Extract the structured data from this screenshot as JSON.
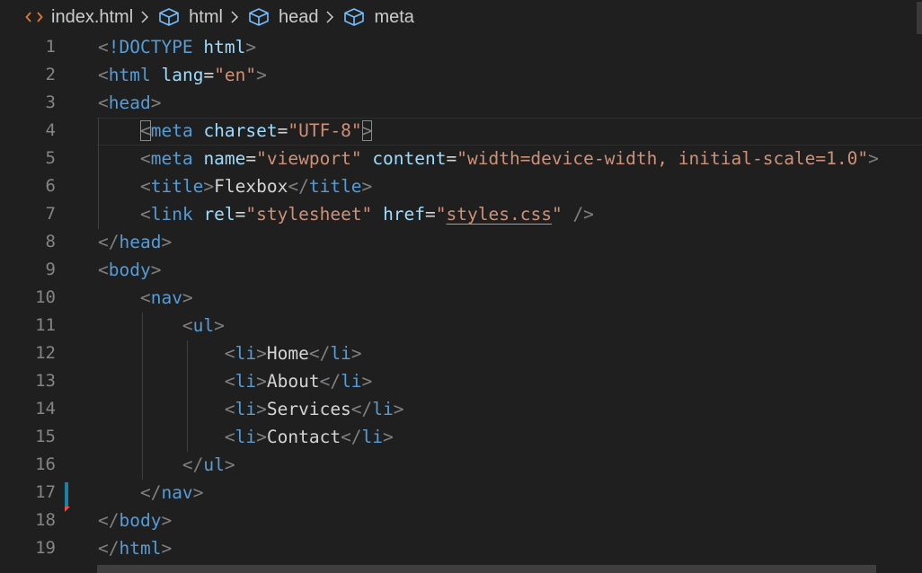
{
  "breadcrumb": {
    "file": "index.html",
    "file_icon": "code-brackets-icon",
    "items": [
      {
        "label": "html",
        "icon": "cube-icon"
      },
      {
        "label": "head",
        "icon": "cube-icon"
      },
      {
        "label": "meta",
        "icon": "cube-icon"
      }
    ]
  },
  "colors": {
    "background": "#1f1f1f",
    "line_number": "#858585",
    "punctuation": "#808080",
    "tag": "#569cd6",
    "attribute": "#9cdcfe",
    "string": "#ce9178",
    "text": "#d4d4d4",
    "git_modified": "#1b81a8",
    "git_deleted": "#f14c4c"
  },
  "editor": {
    "active_line": 4,
    "lines": [
      {
        "n": "1",
        "tokens": [
          [
            "p",
            "<"
          ],
          [
            "t",
            "!DOCTYPE"
          ],
          [
            "x",
            " "
          ],
          [
            "a",
            "html"
          ],
          [
            "p",
            ">"
          ]
        ]
      },
      {
        "n": "2",
        "tokens": [
          [
            "p",
            "<"
          ],
          [
            "t",
            "html"
          ],
          [
            "x",
            " "
          ],
          [
            "a",
            "lang"
          ],
          [
            "x",
            "="
          ],
          [
            "s",
            "\"en\""
          ],
          [
            "p",
            ">"
          ]
        ]
      },
      {
        "n": "3",
        "tokens": [
          [
            "p",
            "<"
          ],
          [
            "t",
            "head"
          ],
          [
            "p",
            ">"
          ]
        ]
      },
      {
        "n": "4",
        "tokens": [
          [
            "x",
            "    "
          ],
          [
            "p",
            "<"
          ],
          [
            "t",
            "meta"
          ],
          [
            "x",
            " "
          ],
          [
            "a",
            "charset"
          ],
          [
            "x",
            "="
          ],
          [
            "s",
            "\"UTF-8\""
          ],
          [
            "p",
            ">"
          ]
        ]
      },
      {
        "n": "5",
        "tokens": [
          [
            "x",
            "    "
          ],
          [
            "p",
            "<"
          ],
          [
            "t",
            "meta"
          ],
          [
            "x",
            " "
          ],
          [
            "a",
            "name"
          ],
          [
            "x",
            "="
          ],
          [
            "s",
            "\"viewport\""
          ],
          [
            "x",
            " "
          ],
          [
            "a",
            "content"
          ],
          [
            "x",
            "="
          ],
          [
            "s",
            "\"width=device-width, initial-scale=1.0\""
          ],
          [
            "p",
            ">"
          ]
        ]
      },
      {
        "n": "6",
        "tokens": [
          [
            "x",
            "    "
          ],
          [
            "p",
            "<"
          ],
          [
            "t",
            "title"
          ],
          [
            "p",
            ">"
          ],
          [
            "x",
            "Flexbox"
          ],
          [
            "p",
            "</"
          ],
          [
            "t",
            "title"
          ],
          [
            "p",
            ">"
          ]
        ]
      },
      {
        "n": "7",
        "tokens": [
          [
            "x",
            "    "
          ],
          [
            "p",
            "<"
          ],
          [
            "t",
            "link"
          ],
          [
            "x",
            " "
          ],
          [
            "a",
            "rel"
          ],
          [
            "x",
            "="
          ],
          [
            "s",
            "\"stylesheet\""
          ],
          [
            "x",
            " "
          ],
          [
            "a",
            "href"
          ],
          [
            "x",
            "="
          ],
          [
            "s",
            "\""
          ],
          [
            "su",
            "styles.css"
          ],
          [
            "s",
            "\""
          ],
          [
            "x",
            " "
          ],
          [
            "p",
            "/>"
          ]
        ]
      },
      {
        "n": "8",
        "tokens": [
          [
            "p",
            "</"
          ],
          [
            "t",
            "head"
          ],
          [
            "p",
            ">"
          ]
        ]
      },
      {
        "n": "9",
        "tokens": [
          [
            "p",
            "<"
          ],
          [
            "t",
            "body"
          ],
          [
            "p",
            ">"
          ]
        ]
      },
      {
        "n": "10",
        "tokens": [
          [
            "x",
            "    "
          ],
          [
            "p",
            "<"
          ],
          [
            "t",
            "nav"
          ],
          [
            "p",
            ">"
          ]
        ]
      },
      {
        "n": "11",
        "tokens": [
          [
            "x",
            "        "
          ],
          [
            "p",
            "<"
          ],
          [
            "t",
            "ul"
          ],
          [
            "p",
            ">"
          ]
        ]
      },
      {
        "n": "12",
        "tokens": [
          [
            "x",
            "            "
          ],
          [
            "p",
            "<"
          ],
          [
            "t",
            "li"
          ],
          [
            "p",
            ">"
          ],
          [
            "x",
            "Home"
          ],
          [
            "p",
            "</"
          ],
          [
            "t",
            "li"
          ],
          [
            "p",
            ">"
          ]
        ]
      },
      {
        "n": "13",
        "tokens": [
          [
            "x",
            "            "
          ],
          [
            "p",
            "<"
          ],
          [
            "t",
            "li"
          ],
          [
            "p",
            ">"
          ],
          [
            "x",
            "About"
          ],
          [
            "p",
            "</"
          ],
          [
            "t",
            "li"
          ],
          [
            "p",
            ">"
          ]
        ]
      },
      {
        "n": "14",
        "tokens": [
          [
            "x",
            "            "
          ],
          [
            "p",
            "<"
          ],
          [
            "t",
            "li"
          ],
          [
            "p",
            ">"
          ],
          [
            "x",
            "Services"
          ],
          [
            "p",
            "</"
          ],
          [
            "t",
            "li"
          ],
          [
            "p",
            ">"
          ]
        ]
      },
      {
        "n": "15",
        "tokens": [
          [
            "x",
            "            "
          ],
          [
            "p",
            "<"
          ],
          [
            "t",
            "li"
          ],
          [
            "p",
            ">"
          ],
          [
            "x",
            "Contact"
          ],
          [
            "p",
            "</"
          ],
          [
            "t",
            "li"
          ],
          [
            "p",
            ">"
          ]
        ]
      },
      {
        "n": "16",
        "tokens": [
          [
            "x",
            "        "
          ],
          [
            "p",
            "</"
          ],
          [
            "t",
            "ul"
          ],
          [
            "p",
            ">"
          ]
        ]
      },
      {
        "n": "17",
        "tokens": [
          [
            "x",
            "    "
          ],
          [
            "p",
            "</"
          ],
          [
            "t",
            "nav"
          ],
          [
            "p",
            ">"
          ]
        ]
      },
      {
        "n": "18",
        "tokens": [
          [
            "p",
            "</"
          ],
          [
            "t",
            "body"
          ],
          [
            "p",
            ">"
          ]
        ]
      },
      {
        "n": "19",
        "tokens": [
          [
            "p",
            "</"
          ],
          [
            "t",
            "html"
          ],
          [
            "p",
            ">"
          ]
        ]
      }
    ]
  }
}
